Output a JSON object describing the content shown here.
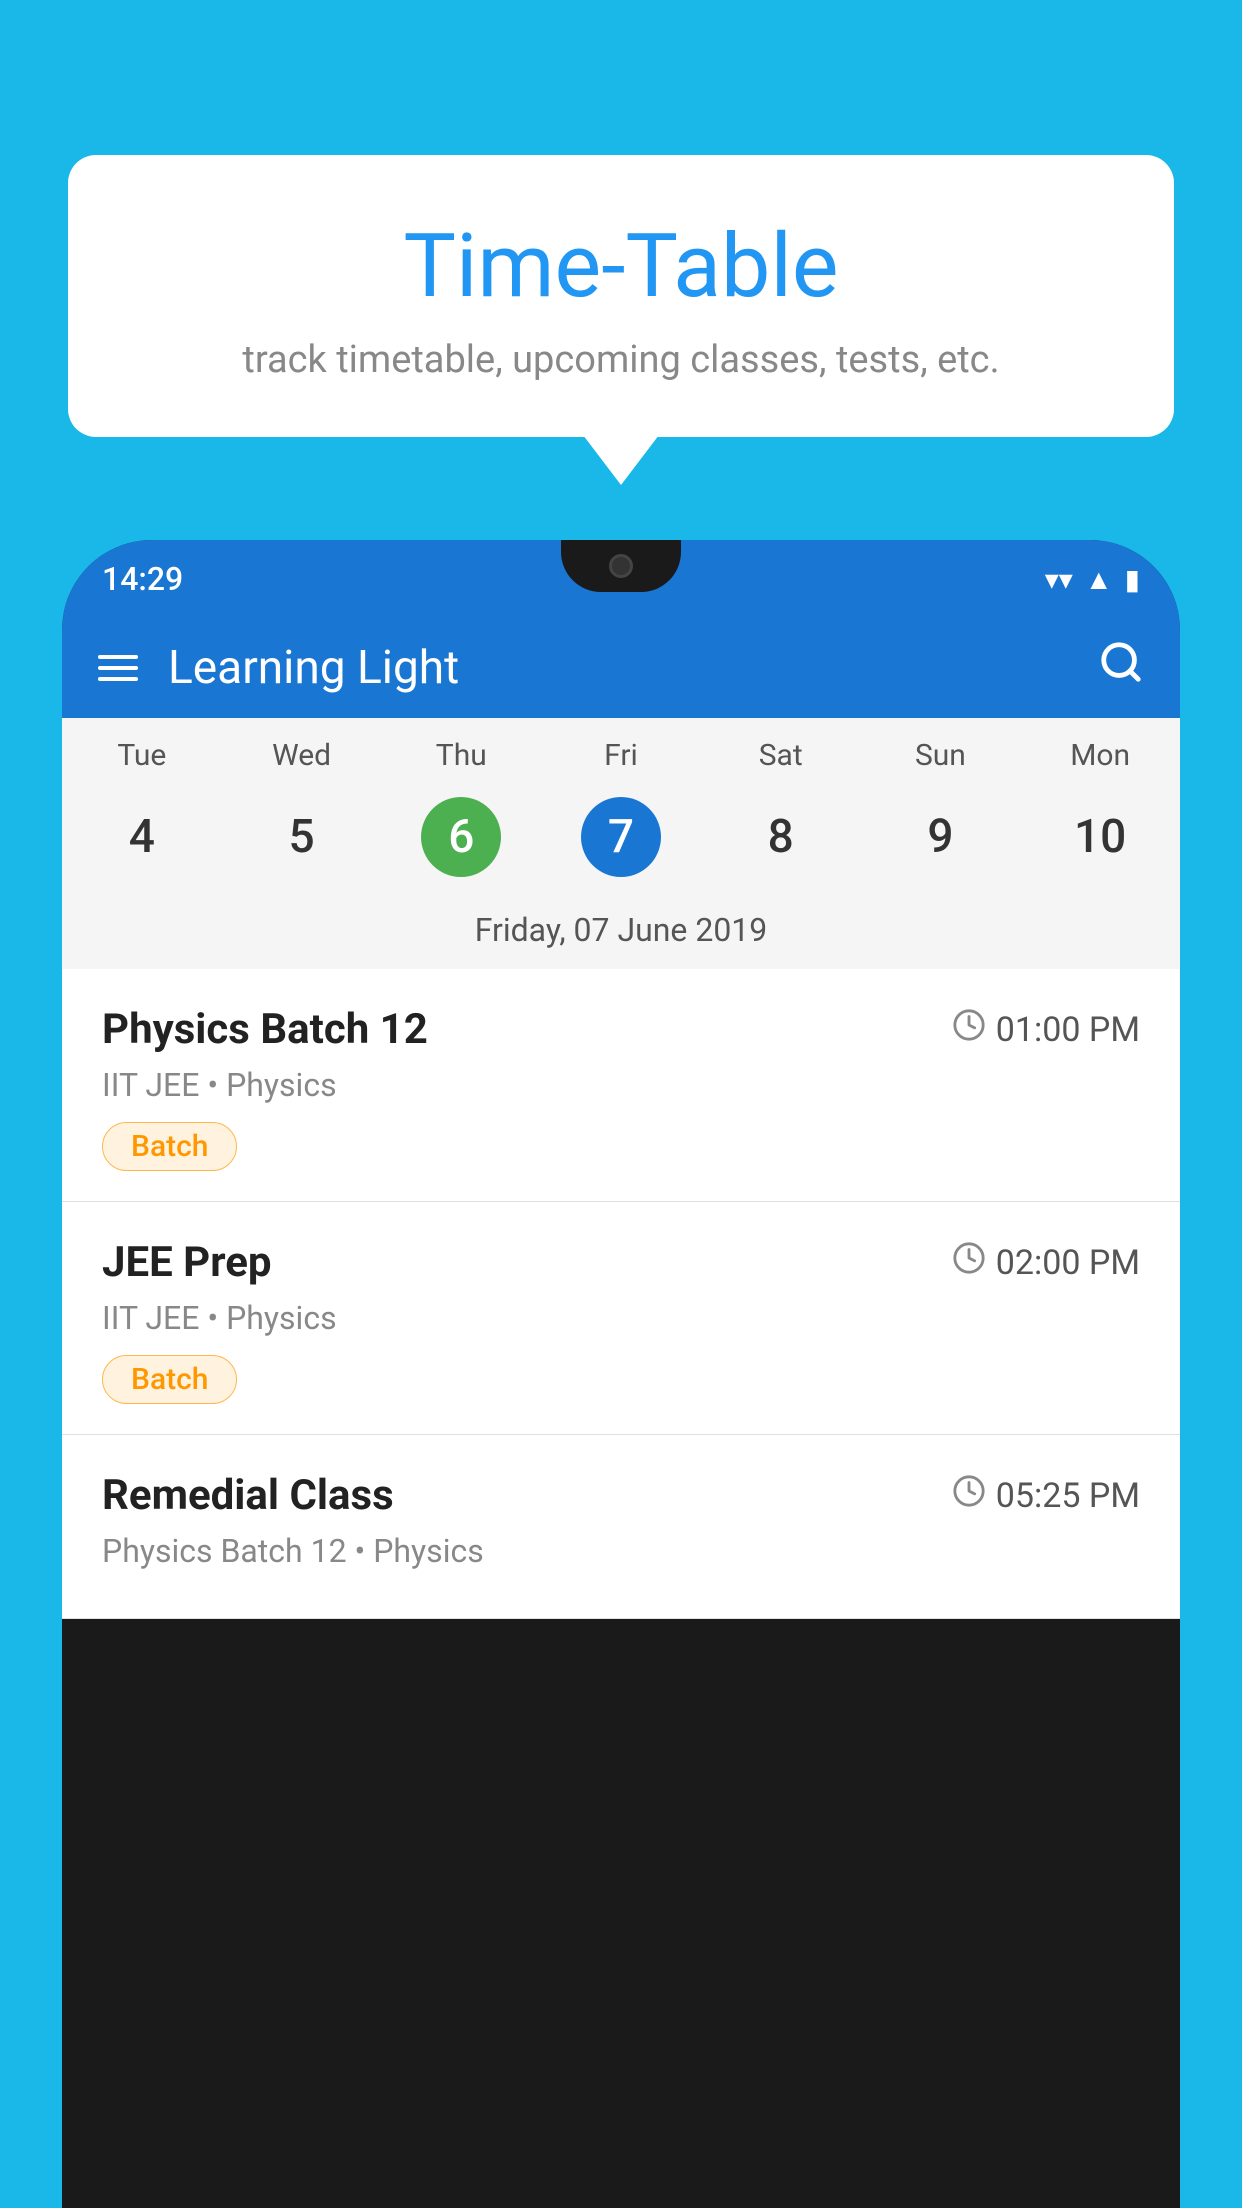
{
  "background_color": "#1ab8e8",
  "bubble": {
    "title": "Time-Table",
    "subtitle": "track timetable, upcoming classes, tests, etc."
  },
  "phone": {
    "status_bar": {
      "time": "14:29",
      "icons": [
        "wifi",
        "signal",
        "battery"
      ]
    },
    "header": {
      "app_name": "Learning Light",
      "hamburger_label": "Menu",
      "search_label": "Search"
    },
    "calendar": {
      "days": [
        "Tue",
        "Wed",
        "Thu",
        "Fri",
        "Sat",
        "Sun",
        "Mon"
      ],
      "dates": [
        "4",
        "5",
        "6",
        "7",
        "8",
        "9",
        "10"
      ],
      "today_index": 2,
      "selected_index": 3,
      "selected_label": "Friday, 07 June 2019"
    },
    "schedule": [
      {
        "title": "Physics Batch 12",
        "time": "01:00 PM",
        "sub": "IIT JEE • Physics",
        "badge": "Batch"
      },
      {
        "title": "JEE Prep",
        "time": "02:00 PM",
        "sub": "IIT JEE • Physics",
        "badge": "Batch"
      },
      {
        "title": "Remedial Class",
        "time": "05:25 PM",
        "sub": "Physics Batch 12 • Physics",
        "badge": ""
      }
    ]
  }
}
